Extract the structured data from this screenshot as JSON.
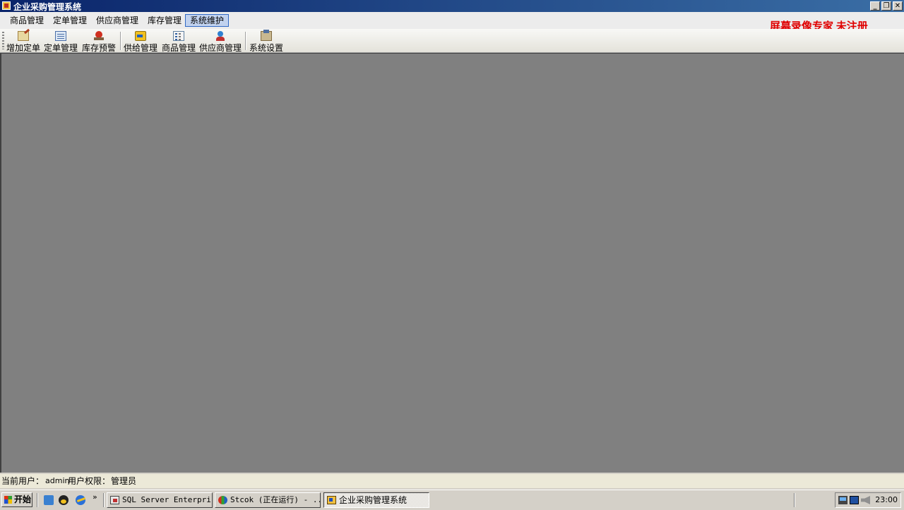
{
  "window": {
    "title": "企业采购管理系统",
    "controls": [
      "minimize",
      "restore",
      "close"
    ]
  },
  "menubar": {
    "items": [
      {
        "label": "商品管理"
      },
      {
        "label": "定单管理"
      },
      {
        "label": "供应商管理"
      },
      {
        "label": "库存管理"
      },
      {
        "label": "系统维护"
      }
    ],
    "active_index": 4
  },
  "watermark": "屏幕录像专家  未注册",
  "toolbar": {
    "buttons": [
      {
        "label": "增加定单",
        "icon": "add-order-icon"
      },
      {
        "label": "定单管理",
        "icon": "order-management-icon"
      },
      {
        "label": "库存预警",
        "icon": "stock-alarm-icon"
      },
      {
        "label": "供给管理",
        "icon": "supply-icon"
      },
      {
        "label": "商品管理",
        "icon": "goods-icon"
      },
      {
        "label": "供应商管理",
        "icon": "vendor-icon"
      },
      {
        "label": "系统设置",
        "icon": "settings-icon"
      }
    ]
  },
  "statusbar": {
    "user_label": "当前用户：",
    "user_value": "admin",
    "perm_label": "用户权限：",
    "perm_value": "管理员"
  },
  "taskbar": {
    "start_label": "开始",
    "quicklaunch": [
      "show-desktop-icon",
      "qq-icon",
      "ie-icon"
    ],
    "more": "»",
    "tasks": [
      {
        "label": "SQL Server Enterpri..."
      },
      {
        "label": "Stcok (正在运行) - ..."
      },
      {
        "label": "企业采购管理系统"
      }
    ],
    "clock": "23:00"
  },
  "colors": {
    "title_bar": "#0a246a",
    "workspace": "#808080",
    "watermark": "#e00000",
    "active_menu": "#c1d2ee"
  }
}
